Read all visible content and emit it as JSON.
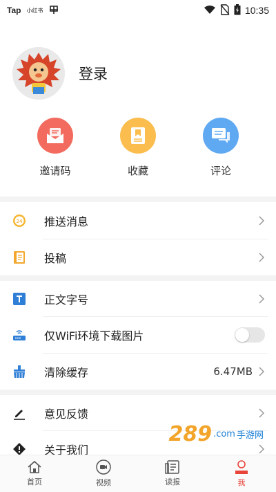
{
  "status_bar": {
    "left_app": "Tap",
    "left_small": "小红书",
    "time": "10:35"
  },
  "profile": {
    "login_label": "登录"
  },
  "actions": [
    {
      "label": "邀请码",
      "icon": "envelope-icon",
      "color": "#f26b5e"
    },
    {
      "label": "收藏",
      "icon": "bookmark-icon",
      "color": "#fbbd4e"
    },
    {
      "label": "评论",
      "icon": "chat-icon",
      "color": "#5fa9f2"
    }
  ],
  "menu": {
    "push": {
      "label": "推送消息",
      "icon": "push-24-icon"
    },
    "submit": {
      "label": "投稿",
      "icon": "notebook-icon"
    },
    "font": {
      "label": "正文字号",
      "icon": "text-size-icon"
    },
    "wifi": {
      "label": "仅WiFi环境下载图片",
      "icon": "router-icon",
      "enabled": false
    },
    "cache": {
      "label": "清除缓存",
      "value": "6.47MB",
      "icon": "broom-icon"
    },
    "feedback": {
      "label": "意见反馈",
      "icon": "pencil-icon"
    },
    "about": {
      "label": "关于我们",
      "icon": "info-icon"
    }
  },
  "tabs": [
    {
      "label": "首页",
      "icon": "home-icon",
      "active": false
    },
    {
      "label": "视频",
      "icon": "video-icon",
      "active": false
    },
    {
      "label": "读报",
      "icon": "newspaper-icon",
      "active": false
    },
    {
      "label": "我",
      "icon": "person-icon",
      "active": true
    }
  ],
  "watermark": {
    "big": "289",
    "suffix": ".com",
    "small": "手游网"
  },
  "colors": {
    "accent": "#e8443a",
    "blue": "#2f7fd6",
    "orange": "#f3a72f"
  }
}
